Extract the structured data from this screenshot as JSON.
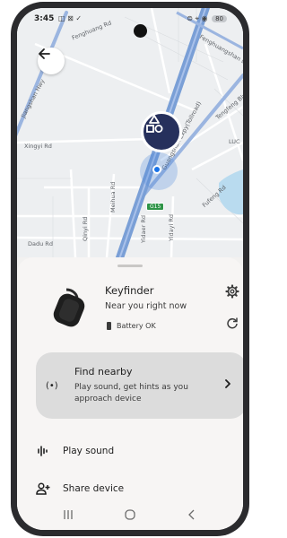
{
  "status_bar": {
    "time": "3:45",
    "left_icons": "◫ ⊠ ✓",
    "right_icons": "⊜ ⌖ ◉",
    "battery": "80"
  },
  "map": {
    "labels": {
      "fenghuang_rd": "Fenghuang Rd",
      "fenghuangshan": "Fenghuangshan Blvd",
      "jiangshan_hwy": "Jiangshan Hwy",
      "xingyi_rd": "Xingyi Rd",
      "guangshan": "Guangshan Expy(Tollroad)",
      "tengfeng": "Tengfeng Blvd",
      "luc": "LUC",
      "meihua_rd": "Meihua Rd",
      "fufeng_rd": "Fufeng Rd",
      "qinyi_rd": "Qinyi Rd",
      "yidaer_rd": "Yidaer Rd",
      "yidayi_rd": "Yidayi Rd",
      "dadu_rd": "Dadu Rd",
      "route": "G15"
    }
  },
  "device": {
    "name": "Keyfinder",
    "status": "Near you right now",
    "battery": "Battery OK"
  },
  "find_nearby": {
    "title": "Find nearby",
    "subtitle": "Play sound, get hints as you approach device",
    "icon": "(•)"
  },
  "actions": {
    "play_sound": "Play sound",
    "share_device": "Share device"
  },
  "icons": [
    "back-arrow-icon",
    "gear-icon",
    "refresh-icon",
    "chevron-right-icon",
    "sound-wave-icon",
    "add-person-icon",
    "device-pin-icon"
  ],
  "colors": {
    "pin": "#26305c",
    "location_dot": "#1a73e8",
    "highway": "#7a9fd6",
    "card": "#dcdcdc"
  }
}
